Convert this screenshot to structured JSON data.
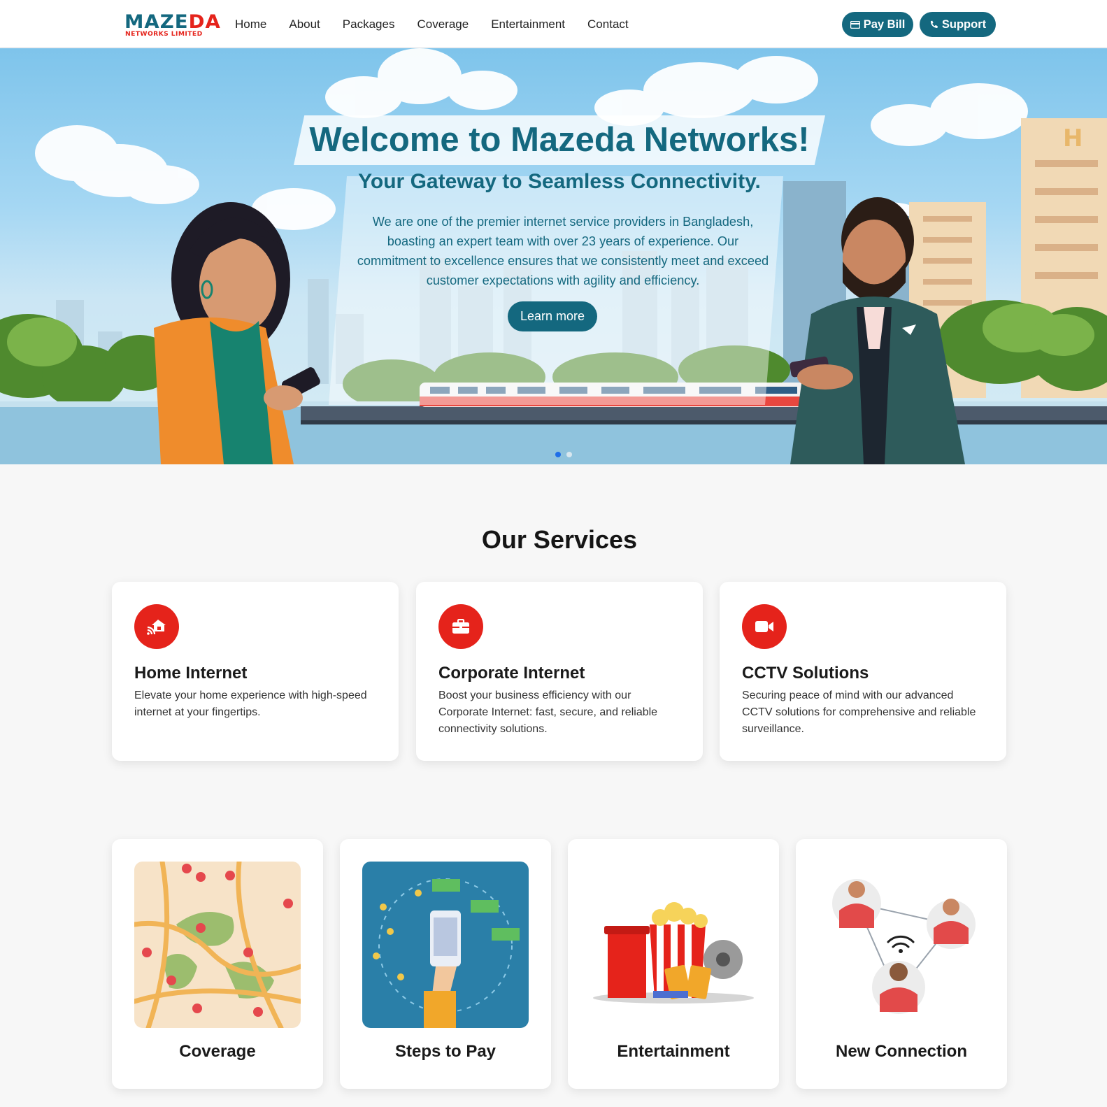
{
  "brand": {
    "logo_word_a": "MAZE",
    "logo_word_b": "DA",
    "logo_sub": "NETWORKS LIMITED"
  },
  "nav": {
    "links": [
      "Home",
      "About",
      "Packages",
      "Coverage",
      "Entertainment",
      "Contact"
    ]
  },
  "actions": {
    "pay_bill": "Pay Bill",
    "support": "Support"
  },
  "hero": {
    "title": "Welcome to Mazeda Networks!",
    "subtitle": "Your Gateway to Seamless Connectivity.",
    "description": "We are one of the premier internet service providers in Bangladesh, boasting an expert team with over 23 years of experience. Our commitment to excellence ensures that we consistently meet and exceed customer expectations with agility and efficiency.",
    "cta": "Learn more",
    "slides": 2,
    "active_slide": 1
  },
  "services": {
    "title": "Our Services",
    "items": [
      {
        "icon": "home-wifi-icon",
        "title": "Home Internet",
        "desc": "Elevate your home experience with high-speed internet at your fingertips."
      },
      {
        "icon": "briefcase-icon",
        "title": "Corporate Internet",
        "desc": "Boost your business efficiency with our Corporate Internet: fast, secure, and reliable connectivity solutions."
      },
      {
        "icon": "video-camera-icon",
        "title": "CCTV Solutions",
        "desc": "Securing peace of mind with our advanced CCTV solutions for comprehensive and reliable surveillance."
      }
    ]
  },
  "tiles": [
    {
      "label": "Coverage",
      "icon": "map-pins-illustration"
    },
    {
      "label": "Steps to Pay",
      "icon": "mobile-payment-illustration"
    },
    {
      "label": "Entertainment",
      "icon": "popcorn-cinema-illustration"
    },
    {
      "label": "New Connection",
      "icon": "people-network-illustration"
    }
  ],
  "colors": {
    "brand_teal": "#14687f",
    "brand_red": "#e5231b",
    "page_bg": "#f7f7f7",
    "active_dot": "#1f6ee8"
  }
}
